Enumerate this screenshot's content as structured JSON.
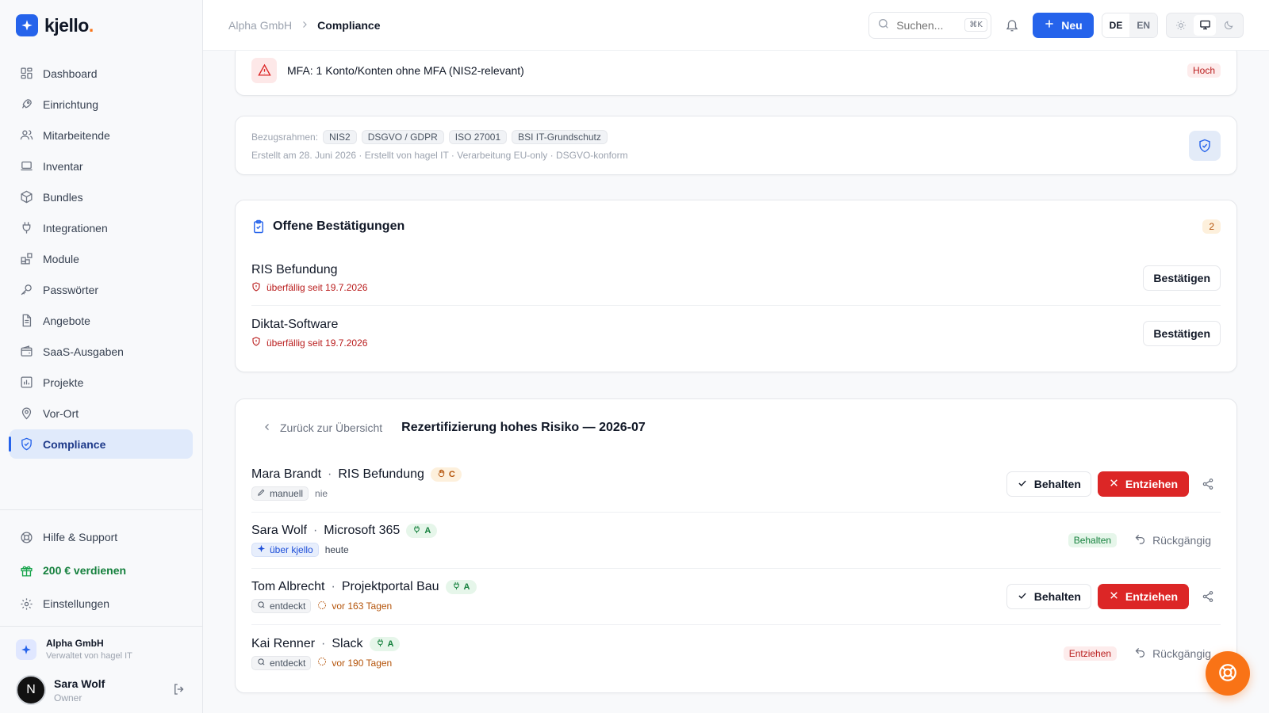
{
  "brand": {
    "name": "kjello",
    "dot": "."
  },
  "sidebar": {
    "items": [
      {
        "label": "Dashboard",
        "icon": "dashboard-icon"
      },
      {
        "label": "Einrichtung",
        "icon": "rocket-icon"
      },
      {
        "label": "Mitarbeitende",
        "icon": "users-icon"
      },
      {
        "label": "Inventar",
        "icon": "laptop-icon"
      },
      {
        "label": "Bundles",
        "icon": "package-icon"
      },
      {
        "label": "Integrationen",
        "icon": "plug-icon"
      },
      {
        "label": "Module",
        "icon": "blocks-icon"
      },
      {
        "label": "Passwörter",
        "icon": "key-icon"
      },
      {
        "label": "Angebote",
        "icon": "document-icon"
      },
      {
        "label": "SaaS-Ausgaben",
        "icon": "wallet-icon"
      },
      {
        "label": "Projekte",
        "icon": "chart-icon"
      },
      {
        "label": "Vor-Ort",
        "icon": "map-pin-icon"
      },
      {
        "label": "Compliance",
        "icon": "shield-check-icon",
        "active": true
      }
    ],
    "bottom": [
      {
        "label": "Hilfe & Support",
        "icon": "lifebuoy-icon"
      },
      {
        "label": "200 € verdienen",
        "icon": "gift-icon"
      },
      {
        "label": "Einstellungen",
        "icon": "gear-icon"
      }
    ],
    "org": {
      "name": "Alpha GmbH",
      "sub": "Verwaltet von hagel IT"
    },
    "user": {
      "initial": "N",
      "name": "Sara Wolf",
      "role": "Owner"
    }
  },
  "topbar": {
    "breadcrumb_org": "Alpha GmbH",
    "breadcrumb_current": "Compliance",
    "search_placeholder": "Suchen...",
    "search_shortcut": "⌘K",
    "new_label": "Neu",
    "lang_de": "DE",
    "lang_en": "EN"
  },
  "alert": {
    "text": "MFA: 1 Konto/Konten ohne MFA (NIS2-relevant)",
    "severity": "Hoch"
  },
  "frameworks": {
    "label": "Bezugsrahmen:",
    "chips": [
      "NIS2",
      "DSGVO / GDPR",
      "ISO 27001",
      "BSI IT-Grundschutz"
    ],
    "meta": "Erstellt am 28. Juni 2026 · Erstellt von hagel IT · Verarbeitung EU-only · DSGVO-konform"
  },
  "pending": {
    "title": "Offene Bestätigungen",
    "count": "2",
    "items": [
      {
        "name": "RIS Befundung",
        "due": "überfällig seit 19.7.2026",
        "action": "Bestätigen"
      },
      {
        "name": "Diktat-Software",
        "due": "überfällig seit 19.7.2026",
        "action": "Bestätigen"
      }
    ]
  },
  "recert": {
    "back_label": "Zurück zur Übersicht",
    "title": "Rezertifizierung hohes Risiko — 2026-07",
    "keep_label": "Behalten",
    "revoke_label": "Entziehen",
    "undo_label": "Rückgängig",
    "rows": [
      {
        "person": "Mara Brandt",
        "app": "RIS Befundung",
        "risk": "C",
        "source": "manuell",
        "when": "nie"
      },
      {
        "person": "Sara Wolf",
        "app": "Microsoft 365",
        "risk": "A",
        "source": "über kjello",
        "when": "heute",
        "state": "Behalten"
      },
      {
        "person": "Tom Albrecht",
        "app": "Projektportal Bau",
        "risk": "A",
        "source": "entdeckt",
        "when": "vor 163 Tagen"
      },
      {
        "person": "Kai Renner",
        "app": "Slack",
        "risk": "A",
        "source": "entdeckt",
        "when": "vor 190 Tagen",
        "state": "Entziehen"
      }
    ]
  },
  "colors": {
    "accent": "#2563eb",
    "danger": "#dc2626",
    "fab": "#f97316"
  }
}
